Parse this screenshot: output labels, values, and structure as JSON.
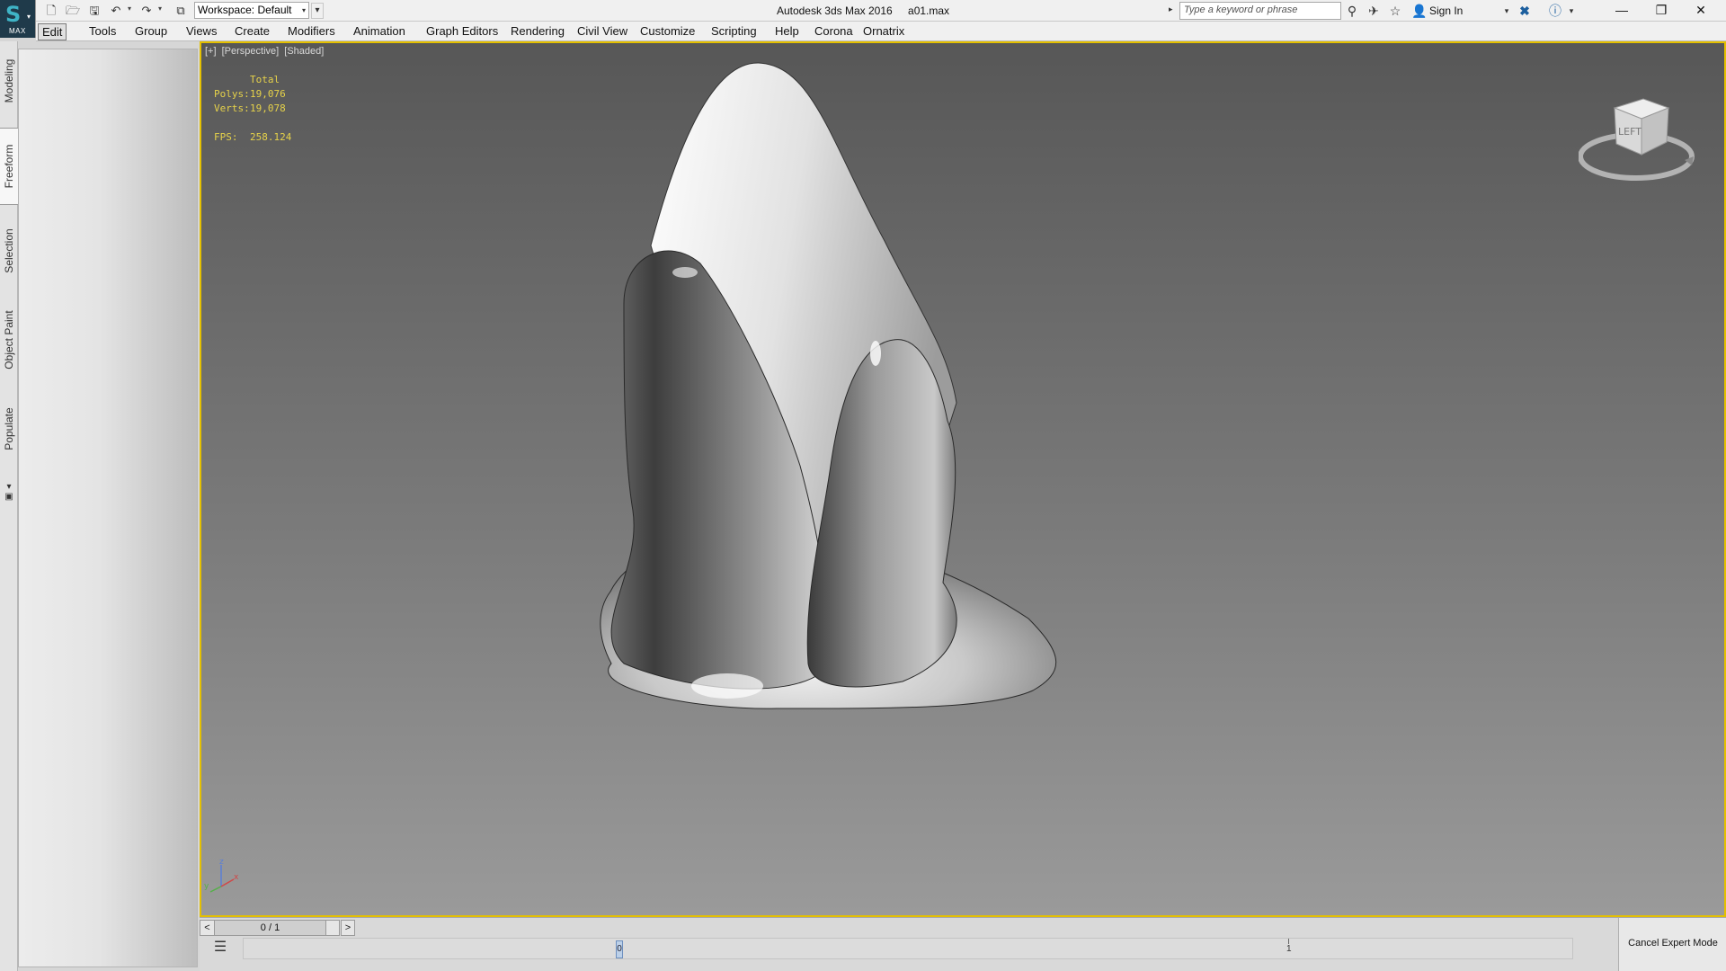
{
  "app": {
    "title": "Autodesk 3ds Max 2016",
    "file": "a01.max",
    "logo_label": "MAX",
    "logo_glyph": "S"
  },
  "quick_access": {
    "workspace": "Workspace: Default",
    "icons": [
      "new-file-icon",
      "open-file-icon",
      "save-icon",
      "undo-icon",
      "redo-icon",
      "project-folder-icon"
    ]
  },
  "search": {
    "placeholder": "Type a keyword or phrase"
  },
  "account": {
    "sign_in": "Sign In"
  },
  "menu": [
    "Edit",
    "Tools",
    "Group",
    "Views",
    "Create",
    "Modifiers",
    "Animation",
    "Graph Editors",
    "Rendering",
    "Civil View",
    "Customize",
    "Scripting",
    "Help",
    "Corona",
    "Ornatrix"
  ],
  "ribbon_tabs": [
    "Modeling",
    "Freeform",
    "Selection",
    "Object Paint",
    "Populate"
  ],
  "viewport": {
    "labels": [
      "[+]",
      "[Perspective]",
      "[Shaded]"
    ],
    "stats": {
      "header": "Total",
      "polys_label": "Polys:",
      "polys": "19,076",
      "verts_label": "Verts:",
      "verts": "19,078",
      "fps_label": "FPS:",
      "fps": "258.124"
    },
    "viewcube_label": "LEFT",
    "axis": {
      "x": "x",
      "y": "y",
      "z": "z"
    }
  },
  "timeline": {
    "slider_value": "0 / 1",
    "prev": "<",
    "next": ">",
    "marker_label": "0",
    "tick_label": "1",
    "cancel_expert": "Cancel Expert Mode"
  }
}
